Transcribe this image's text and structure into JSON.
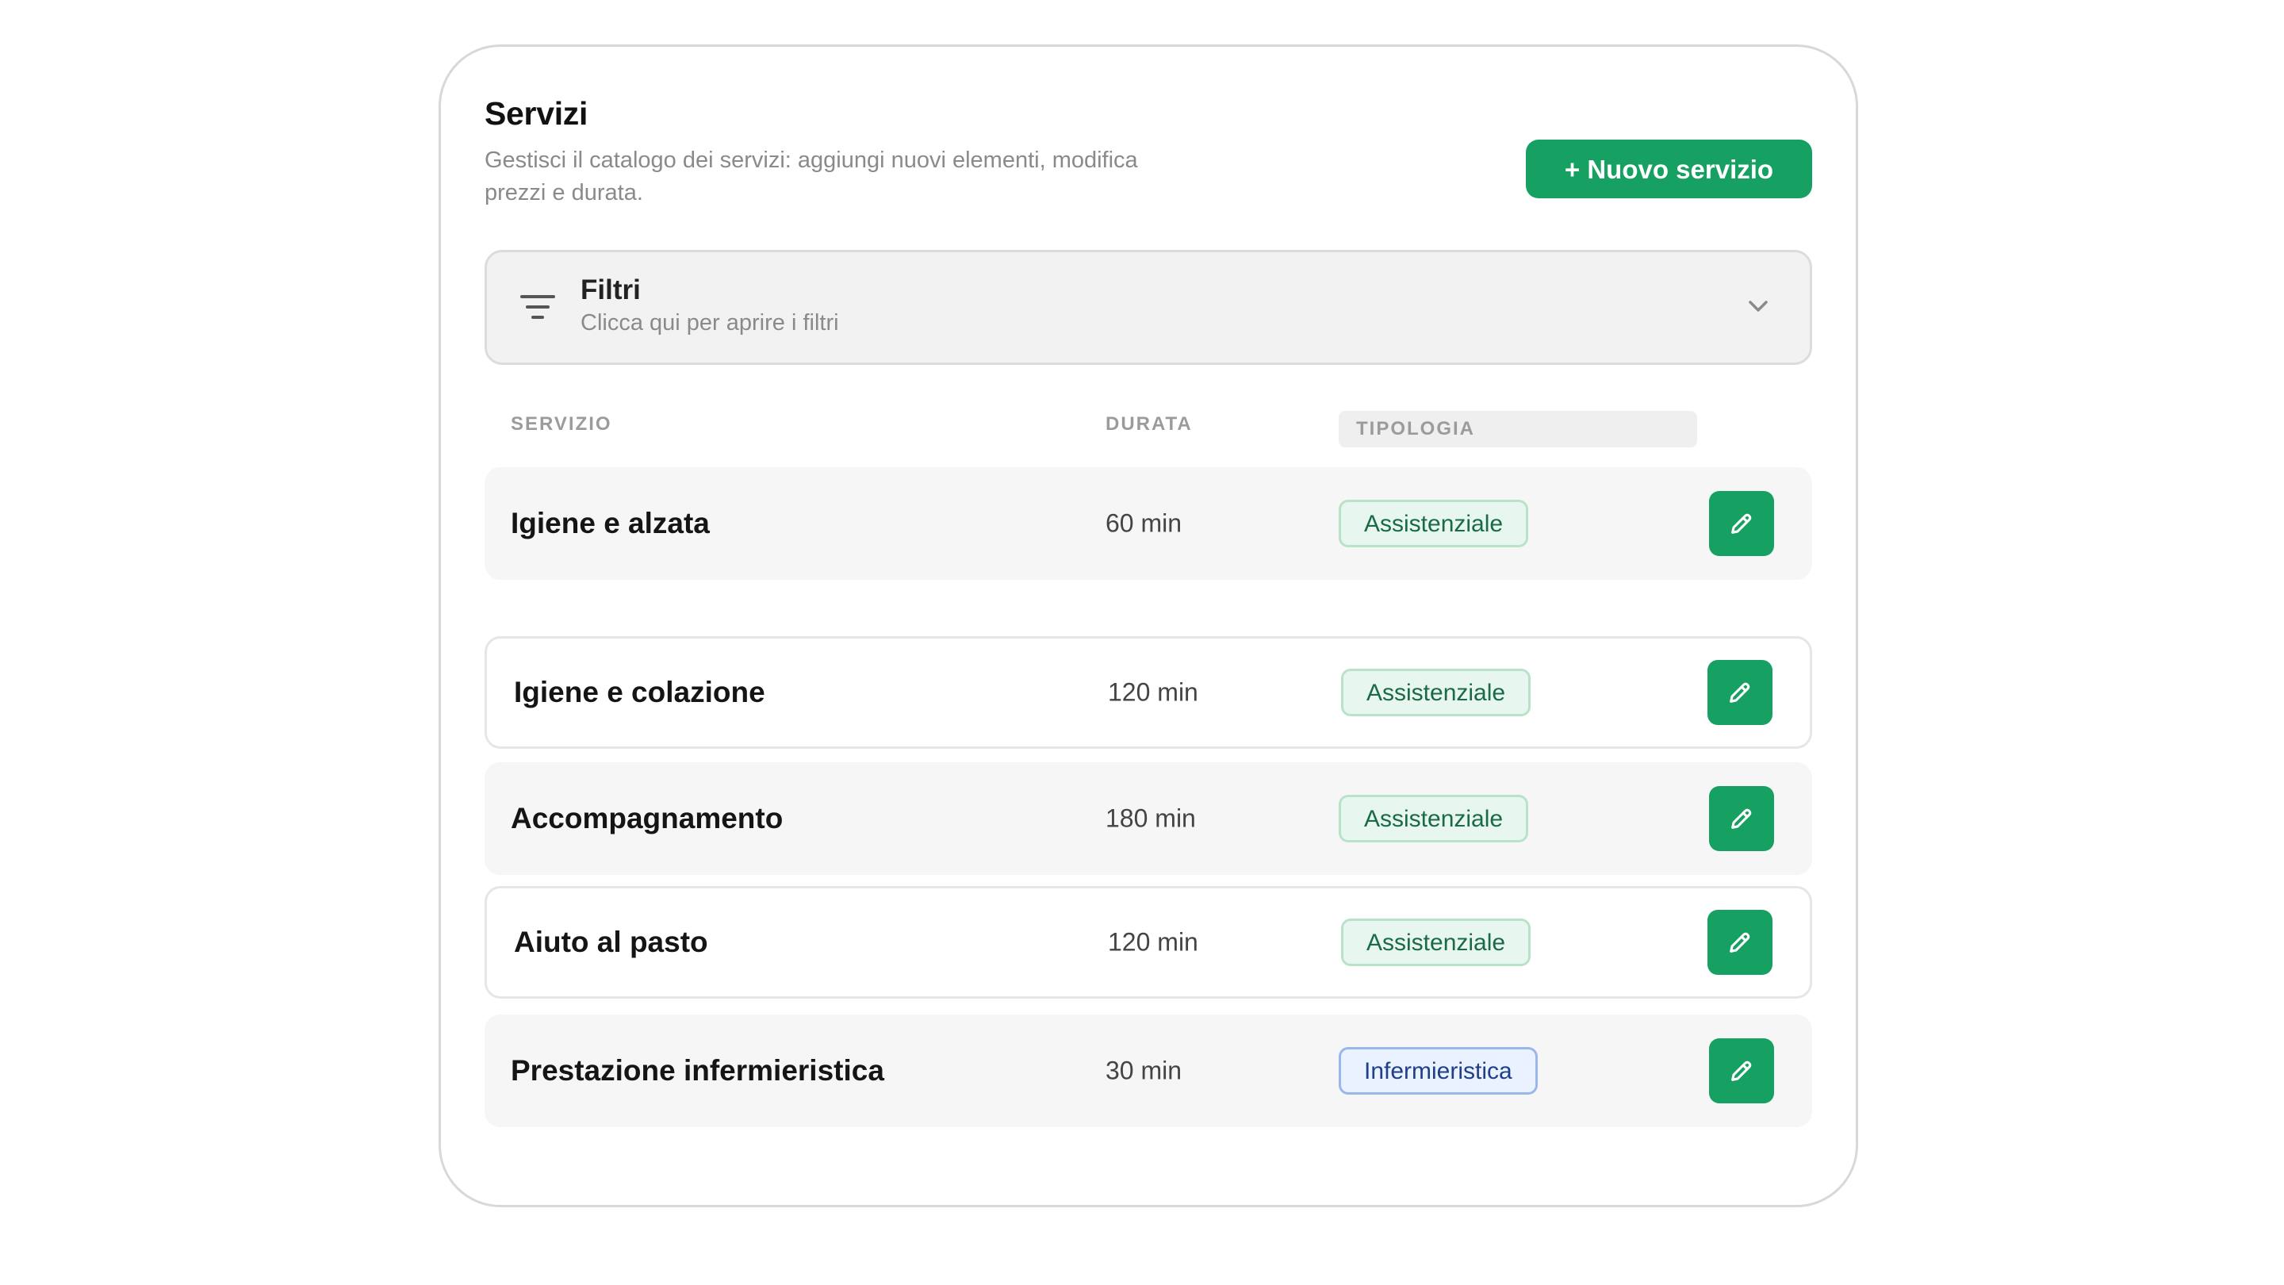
{
  "header": {
    "title": "Servizi",
    "subtitle": "Gestisci il catalogo dei servizi: aggiungi nuovi elementi, modifica prezzi e durata.",
    "new_button_label": "+ Nuovo servizio"
  },
  "filters": {
    "title": "Filtri",
    "hint": "Clicca qui per aprire i filtri",
    "icon": "filter-icon",
    "toggle_icon": "chevron-down-icon"
  },
  "table": {
    "columns": [
      "SERVIZIO",
      "DURATA",
      "TIPOLOGIA"
    ],
    "rows": [
      {
        "name": "Igiene e alzata",
        "duration": "60 min",
        "type": "Assistenziale",
        "type_color": "green"
      },
      {
        "name": "Igiene e colazione",
        "duration": "120 min",
        "type": "Assistenziale",
        "type_color": "green"
      },
      {
        "name": "Accompagnamento",
        "duration": "180 min",
        "type": "Assistenziale",
        "type_color": "green"
      },
      {
        "name": "Aiuto al pasto",
        "duration": "120 min",
        "type": "Assistenziale",
        "type_color": "green"
      },
      {
        "name": "Prestazione infermieristica",
        "duration": "30 min",
        "type": "Infermieristica",
        "type_color": "blue"
      }
    ],
    "edit_icon": "pencil-icon"
  },
  "colors": {
    "accent": "#16a062",
    "badge_green_bg": "#e7f6ee",
    "badge_green_text": "#1a6a45",
    "badge_blue_bg": "#eaf1ff",
    "badge_blue_text": "#1f3f86"
  }
}
